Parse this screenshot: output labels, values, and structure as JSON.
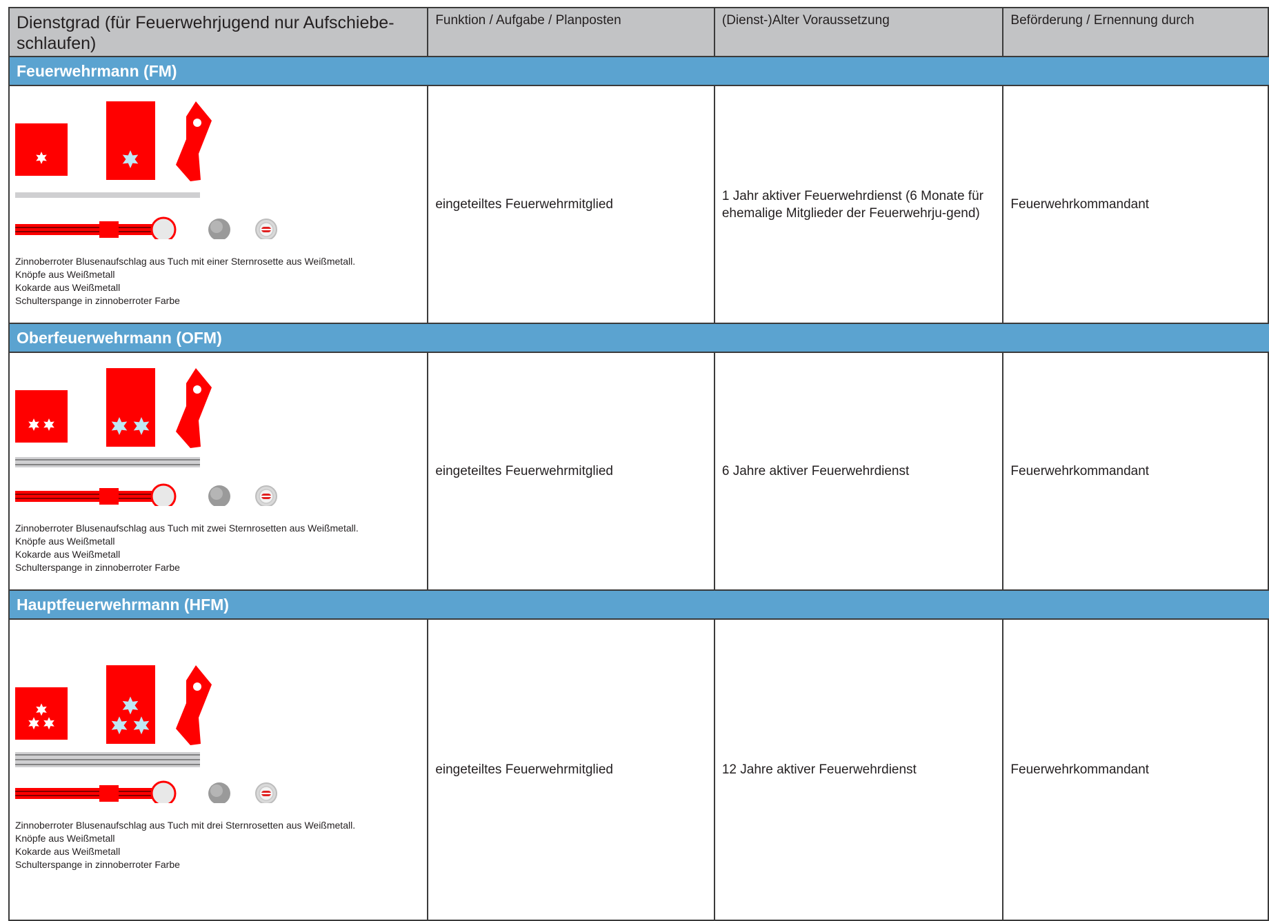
{
  "header": {
    "col1": "Dienstgrad (für Feuerwehrjugend nur Aufschiebe-schlaufen)",
    "col2": "Funktion / Aufgabe / Planposten",
    "col3": "(Dienst-)Alter Voraussetzung",
    "col4": "Beförderung / Ernennung durch"
  },
  "colors": {
    "header_bg": "#c2c3c5",
    "rank_bar": "#5ba3d0",
    "insignia_red": "#ff0000",
    "star_blue": "#bfe8f5"
  },
  "ranks": [
    {
      "title": "Feuerwehrmann (FM)",
      "stars": 1,
      "desc_lines": [
        "Zinnoberroter Blusenaufschlag aus Tuch mit einer Sternrosette aus Weißmetall.",
        "Knöpfe aus Weißmetall",
        "Kokarde aus Weißmetall",
        "Schulterspange in zinnoberroter Farbe"
      ],
      "function": "eingeteiltes Feuerwehrmitglied",
      "requirement": "1 Jahr aktiver Feuerwehrdienst (6 Monate für ehemalige Mitglieder der Feuerwehrju-gend)",
      "promotion": "Feuerwehrkommandant"
    },
    {
      "title": "Oberfeuerwehrmann (OFM)",
      "stars": 2,
      "desc_lines": [
        "Zinnoberroter Blusenaufschlag aus Tuch mit zwei Sternrosetten aus Weißmetall.",
        "Knöpfe aus Weißmetall",
        "Kokarde aus Weißmetall",
        "Schulterspange in zinnoberroter Farbe"
      ],
      "function": "eingeteiltes Feuerwehrmitglied",
      "requirement": "6 Jahre aktiver Feuerwehrdienst",
      "promotion": "Feuerwehrkommandant"
    },
    {
      "title": "Hauptfeuerwehrmann (HFM)",
      "stars": 3,
      "desc_lines": [
        "Zinnoberroter Blusenaufschlag aus Tuch mit drei Sternrosetten aus Weißmetall.",
        "Knöpfe aus Weißmetall",
        "Kokarde aus Weißmetall",
        "Schulterspange in zinnoberroter Farbe"
      ],
      "function": "eingeteiltes Feuerwehrmitglied",
      "requirement": "12 Jahre aktiver Feuerwehrdienst",
      "promotion": "Feuerwehrkommandant"
    }
  ]
}
